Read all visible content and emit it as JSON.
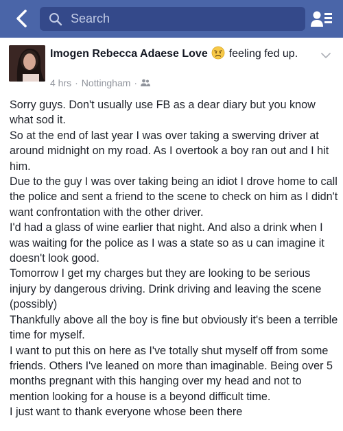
{
  "nav": {
    "back_icon": "chevron-left-icon",
    "search_placeholder": "Search",
    "friends_icon": "friend-requests-icon",
    "bar_color": "#4a65a8"
  },
  "post": {
    "author": "Imogen Rebecca Adaese Love",
    "feeling_emoji": "sad-face-emoji",
    "feeling": "feeling fed up.",
    "time": "4 hrs",
    "location": "Nottingham",
    "audience_icon": "friends-audience-icon",
    "menu_icon": "chevron-down-icon",
    "paragraphs": [
      "Sorry guys. Don't usually use FB as a dear diary but you know what sod it.",
      "So at the end of last year I was over taking a swerving driver at around midnight on my road. As I overtook a boy ran out and I hit him.",
      "Due to the guy I was over taking being an idiot I drove home to call the police and sent a friend to the scene to check on him as I didn't want confrontation with the other driver.",
      "I'd had a glass of wine earlier that night. And also a drink when I was waiting for the police as I was a state so as u can imagine it doesn't look good.",
      "Tomorrow I get my charges but they are looking to be serious injury by dangerous driving. Drink driving and leaving the scene (possibly)",
      "Thankfully above all the boy is fine but obviously it's been a terrible time for myself.",
      "I want to put this on here as I've totally shut myself off from some friends. Others I've leaned on more than imaginable. Being over 5 months pregnant with this hanging over my head and not to mention looking for a house is a beyond difficult time.",
      "I just want to thank everyone whose been there"
    ]
  }
}
